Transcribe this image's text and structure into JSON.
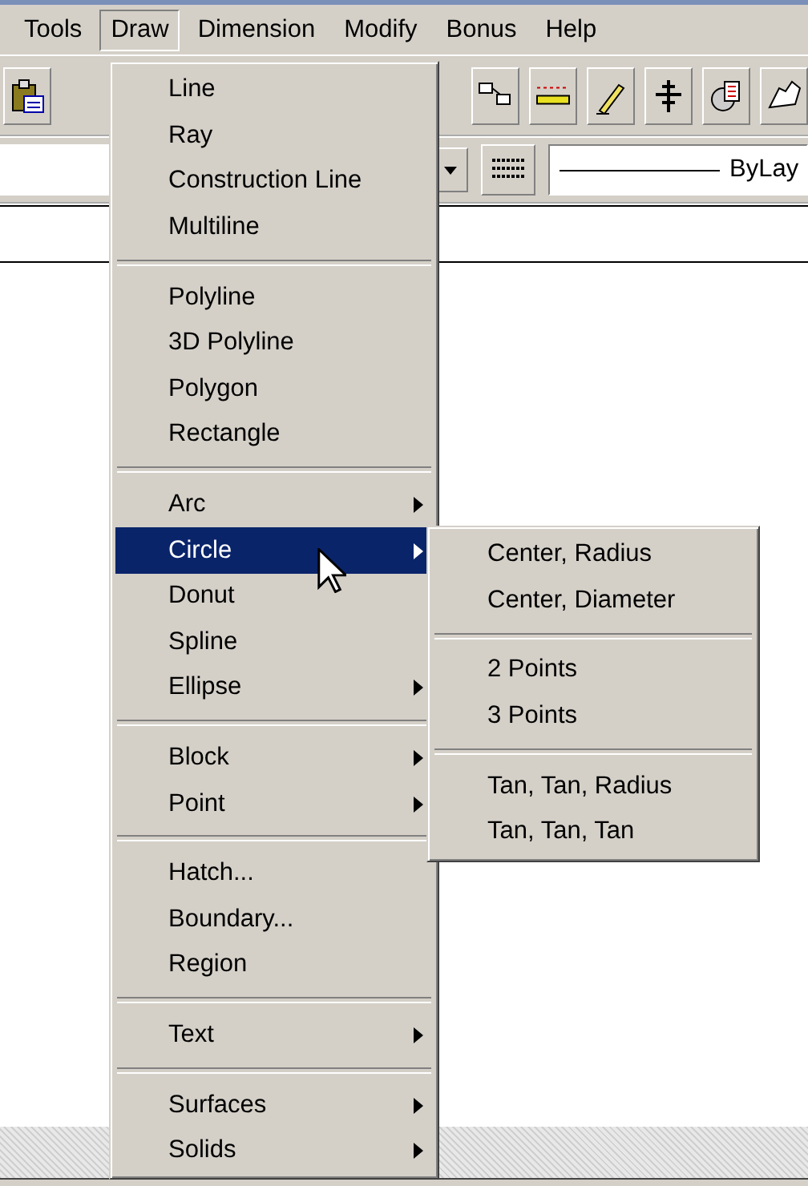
{
  "menubar": [
    {
      "label": "Tools",
      "selected": false
    },
    {
      "label": "Draw",
      "selected": true
    },
    {
      "label": "Dimension",
      "selected": false
    },
    {
      "label": "Modify",
      "selected": false
    },
    {
      "label": "Bonus",
      "selected": false
    },
    {
      "label": "Help",
      "selected": false
    }
  ],
  "toolbar": {
    "linetype_field": {
      "value": "ByLay"
    }
  },
  "draw_menu": [
    {
      "kind": "item",
      "label": "Line",
      "submenu": false,
      "selected": false
    },
    {
      "kind": "item",
      "label": "Ray",
      "submenu": false,
      "selected": false
    },
    {
      "kind": "item",
      "label": "Construction Line",
      "submenu": false,
      "selected": false
    },
    {
      "kind": "item",
      "label": "Multiline",
      "submenu": false,
      "selected": false
    },
    {
      "kind": "separator"
    },
    {
      "kind": "item",
      "label": "Polyline",
      "submenu": false,
      "selected": false
    },
    {
      "kind": "item",
      "label": "3D Polyline",
      "submenu": false,
      "selected": false
    },
    {
      "kind": "item",
      "label": "Polygon",
      "submenu": false,
      "selected": false
    },
    {
      "kind": "item",
      "label": "Rectangle",
      "submenu": false,
      "selected": false
    },
    {
      "kind": "separator"
    },
    {
      "kind": "item",
      "label": "Arc",
      "submenu": true,
      "selected": false
    },
    {
      "kind": "item",
      "label": "Circle",
      "submenu": true,
      "selected": true
    },
    {
      "kind": "item",
      "label": "Donut",
      "submenu": false,
      "selected": false
    },
    {
      "kind": "item",
      "label": "Spline",
      "submenu": false,
      "selected": false
    },
    {
      "kind": "item",
      "label": "Ellipse",
      "submenu": true,
      "selected": false
    },
    {
      "kind": "separator"
    },
    {
      "kind": "item",
      "label": "Block",
      "submenu": true,
      "selected": false
    },
    {
      "kind": "item",
      "label": "Point",
      "submenu": true,
      "selected": false
    },
    {
      "kind": "separator"
    },
    {
      "kind": "item",
      "label": "Hatch...",
      "submenu": false,
      "selected": false
    },
    {
      "kind": "item",
      "label": "Boundary...",
      "submenu": false,
      "selected": false
    },
    {
      "kind": "item",
      "label": "Region",
      "submenu": false,
      "selected": false
    },
    {
      "kind": "separator"
    },
    {
      "kind": "item",
      "label": "Text",
      "submenu": true,
      "selected": false
    },
    {
      "kind": "separator"
    },
    {
      "kind": "item",
      "label": "Surfaces",
      "submenu": true,
      "selected": false
    },
    {
      "kind": "item",
      "label": "Solids",
      "submenu": true,
      "selected": false
    }
  ],
  "circle_submenu": [
    {
      "kind": "item",
      "label": "Center, Radius",
      "selected": false
    },
    {
      "kind": "item",
      "label": "Center, Diameter",
      "selected": false
    },
    {
      "kind": "separator"
    },
    {
      "kind": "item",
      "label": "2 Points",
      "selected": false
    },
    {
      "kind": "item",
      "label": "3 Points",
      "selected": false
    },
    {
      "kind": "separator"
    },
    {
      "kind": "item",
      "label": "Tan, Tan, Radius",
      "selected": false
    },
    {
      "kind": "item",
      "label": "Tan, Tan, Tan",
      "selected": false
    }
  ]
}
